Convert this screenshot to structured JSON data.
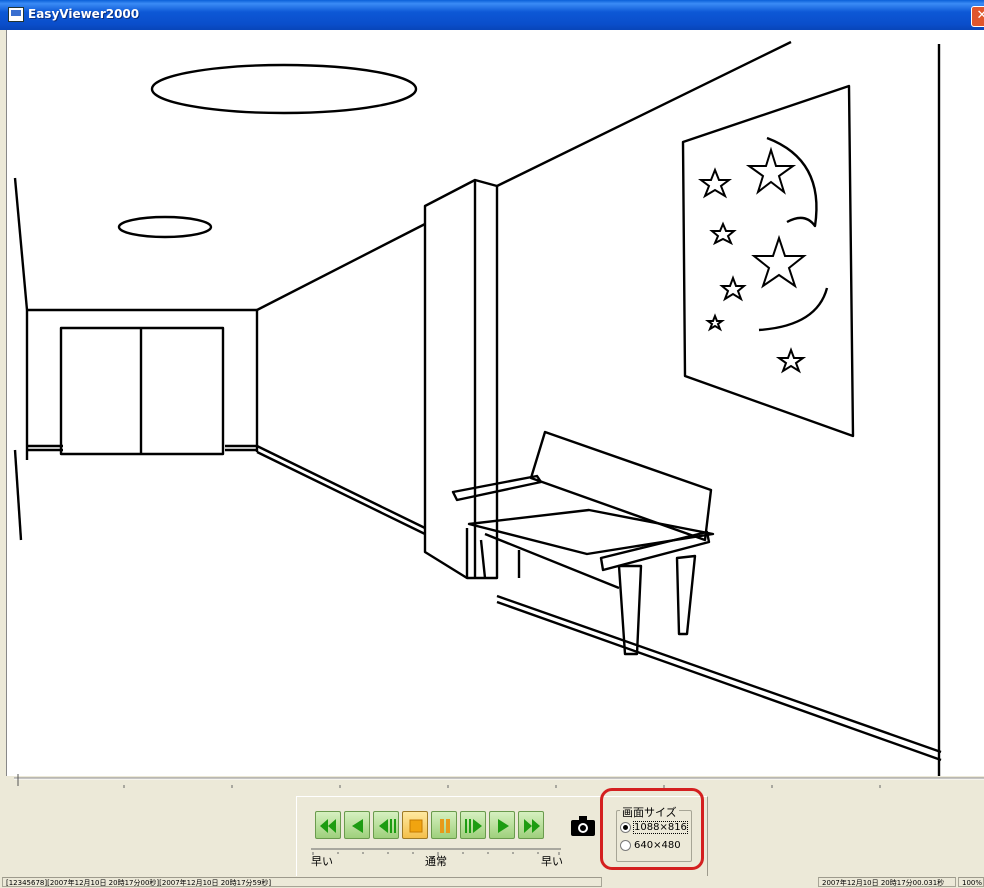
{
  "window": {
    "title": "EasyViewer2000",
    "close_label": "✕"
  },
  "viewport": {
    "image_content": "line-drawing hallway scene"
  },
  "playback": {
    "buttons": [
      {
        "name": "fast-rewind-button",
        "icon": "double-left-arrow"
      },
      {
        "name": "reverse-play-button",
        "icon": "left-arrow"
      },
      {
        "name": "step-back-button",
        "icon": "step-back"
      },
      {
        "name": "stop-button",
        "icon": "stop-square",
        "active": true
      },
      {
        "name": "pause-button",
        "icon": "pause"
      },
      {
        "name": "step-forward-button",
        "icon": "step-forward"
      },
      {
        "name": "play-button",
        "icon": "right-arrow"
      },
      {
        "name": "fast-forward-button",
        "icon": "double-right-arrow"
      }
    ],
    "snapshot_icon": "camera-icon",
    "speed": {
      "left_label": "早い",
      "center_label": "通常",
      "right_label": "早い"
    }
  },
  "screen_size": {
    "legend": "画面サイズ",
    "options": [
      {
        "label": "1088×816",
        "selected": true
      },
      {
        "label": "640×480",
        "selected": false
      }
    ]
  },
  "statusbar": {
    "left": "[12345678][2007年12月10日 20時17分00秒][2007年12月10日 20時17分59秒]",
    "time": "2007年12月10日 20時17分00.031秒",
    "zoom": "100%"
  },
  "colors": {
    "titlebar": "#0a4ecb",
    "highlight": "#d42020",
    "button_green": "#3fae2a",
    "button_active": "#f4bf4a"
  }
}
